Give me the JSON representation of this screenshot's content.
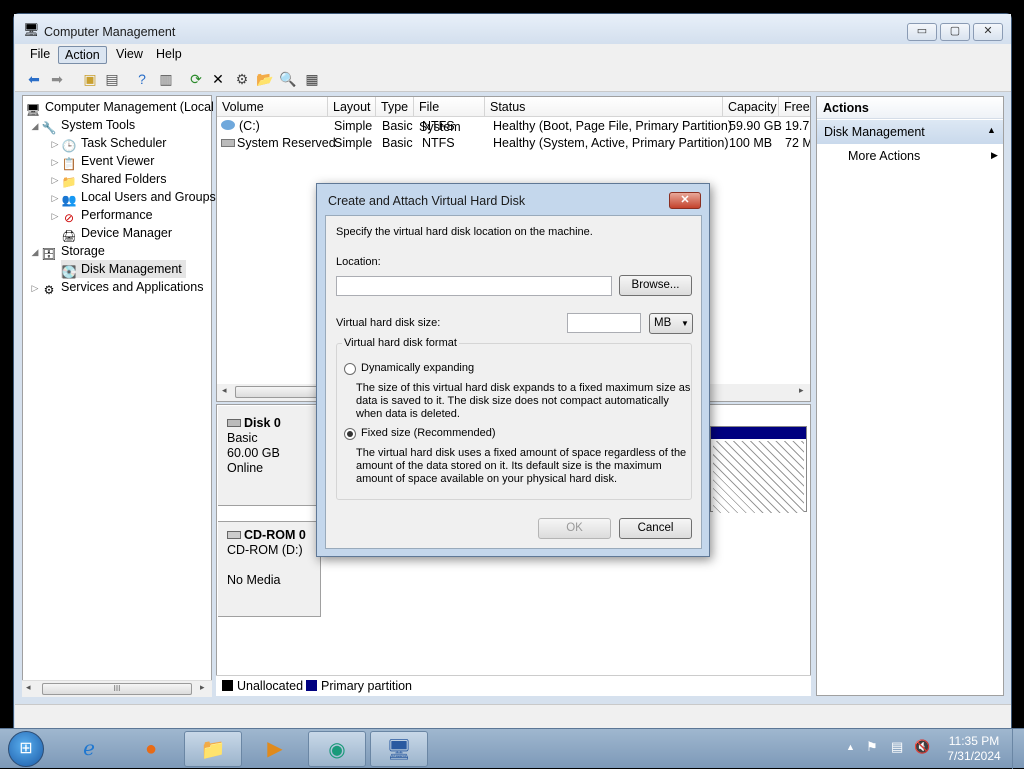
{
  "window": {
    "title": "Computer Management",
    "min": "▭",
    "max": "▢",
    "close": "✕"
  },
  "menu": {
    "file": "File",
    "action": "Action",
    "view": "View",
    "help": "Help"
  },
  "tree": {
    "root": "Computer Management (Local",
    "system_tools": "System Tools",
    "task_scheduler": "Task Scheduler",
    "event_viewer": "Event Viewer",
    "shared_folders": "Shared Folders",
    "local_users": "Local Users and Groups",
    "performance": "Performance",
    "device_manager": "Device Manager",
    "storage": "Storage",
    "disk_management": "Disk Management",
    "services": "Services and Applications",
    "scroll_grip": "III"
  },
  "grid": {
    "headers": [
      "Volume",
      "Layout",
      "Type",
      "File System",
      "Status",
      "Capacity",
      "Free"
    ],
    "rows": [
      [
        "(C:)",
        "Simple",
        "Basic",
        "NTFS",
        "Healthy (Boot, Page File, Primary Partition)",
        "59.90 GB",
        "19.7"
      ],
      [
        "System Reserved",
        "Simple",
        "Basic",
        "NTFS",
        "Healthy (System, Active, Primary Partition)",
        "100 MB",
        "72 M"
      ]
    ]
  },
  "disks": {
    "disk0": {
      "name": "Disk 0",
      "type": "Basic",
      "size": "60.00 GB",
      "state": "Online"
    },
    "cdrom0": {
      "name": "CD-ROM 0",
      "drive": "CD-ROM (D:)",
      "media": "No Media"
    }
  },
  "legend": {
    "unallocated": "Unallocated",
    "primary": "Primary partition",
    "unallocated_color": "#000000",
    "primary_color": "#000080"
  },
  "actions": {
    "header": "Actions",
    "section": "Disk Management",
    "more": "More Actions"
  },
  "dialog": {
    "title": "Create and Attach Virtual Hard Disk",
    "intro": "Specify the virtual hard disk location on the machine.",
    "location_label": "Location:",
    "location_value": "",
    "browse": "Browse...",
    "size_label": "Virtual hard disk size:",
    "size_value": "",
    "unit": "MB",
    "format_group": "Virtual hard disk format",
    "dynamic_label": "Dynamically expanding",
    "dynamic_desc1": "The size of this virtual hard disk expands to a fixed maximum size as",
    "dynamic_desc2": "data is saved to it.  The disk size does not compact automatically",
    "dynamic_desc3": "when data is deleted.",
    "fixed_label": "Fixed size (Recommended)",
    "fixed_desc1": "The virtual hard disk uses a fixed amount of space regardless of the",
    "fixed_desc2": "amount of the data stored on it.  Its default size is the maximum",
    "fixed_desc3": "amount of space available on your physical hard disk.",
    "ok": "OK",
    "cancel": "Cancel",
    "selected_format": "fixed"
  },
  "taskbar": {
    "time": "11:35 PM",
    "date": "7/31/2024"
  }
}
